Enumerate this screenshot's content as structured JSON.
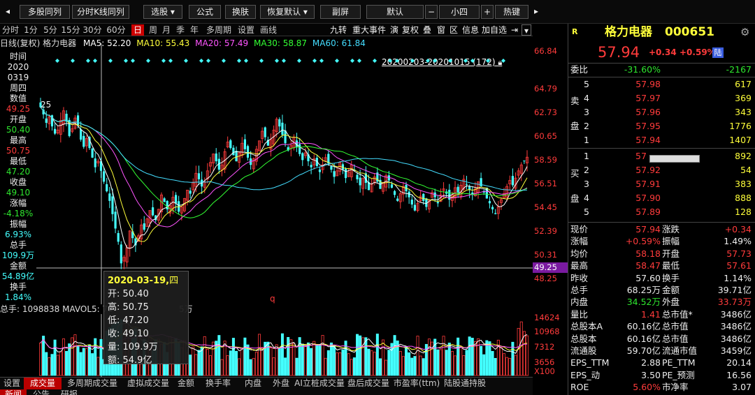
{
  "toolbar": {
    "buttons": [
      "多股同列",
      "分时K线同列",
      "选股 ▾",
      "公式",
      "换肤",
      "恢复默认 ▾",
      "副屏",
      "默认",
      "小四",
      "热键"
    ],
    "scroll_left": "◂",
    "scroll_right": "▸",
    "minus": "−",
    "plus": "+"
  },
  "periods": [
    "分时",
    "1分",
    "5分",
    "15分",
    "30分",
    "60分",
    "日",
    "周",
    "月",
    "季",
    "年",
    "多周期",
    "设置",
    "画线"
  ],
  "active_period": "日",
  "right_tools": [
    "九转",
    "重大事件",
    "演",
    "复权",
    "叠",
    "窗",
    "区",
    "信息",
    "加自选",
    "⇥"
  ],
  "header": {
    "label": "日线(复权) 格力电器",
    "ma5": "MA5: 52.20",
    "ma10": "MA10: 55.43",
    "ma20": "MA20: 57.49",
    "ma30": "MA30: 58.87",
    "ma60": "MA60: 61.84",
    "range": "20200203-20201015 (172)",
    "colors": {
      "ma5": "#ffffff",
      "ma10": "#ffff3a",
      "ma20": "#ff55ff",
      "ma30": "#33ff33",
      "ma60": "#44ddff"
    }
  },
  "price_axis": [
    "66.84",
    "64.79",
    "62.73",
    "60.65",
    "58.59",
    "56.51",
    "54.45",
    "52.39",
    "50.31",
    "48.25"
  ],
  "crosshair_price": "49.25",
  "vol_axis": [
    "14624",
    "10968",
    "7312",
    "3656",
    "X100"
  ],
  "left_info": [
    {
      "k": "时间",
      "v": "2020"
    },
    {
      "k": "0319",
      "v": "周四"
    },
    {
      "k": "数值",
      "v": "49.25"
    },
    {
      "k": "开盘",
      "v": "50.40"
    },
    {
      "k": "最高",
      "v": "50.75"
    },
    {
      "k": "最低",
      "v": "47.20"
    },
    {
      "k": "收盘",
      "v": "49.10"
    },
    {
      "k": "涨幅",
      "v": "-4.18%"
    },
    {
      "k": "振幅",
      "v": "6.93%"
    },
    {
      "k": "总手",
      "v": "109.9万"
    },
    {
      "k": "金额",
      "v": "54.89亿"
    },
    {
      "k": "换手",
      "v": "1.84%"
    }
  ],
  "chart_marker": "25",
  "low_marker": "q",
  "vol_header": "总手: 1098838  MAVOL5: 70",
  "vol_header_tail": "5万",
  "tooltip": {
    "date": "2020-03-19,",
    "weekday": "四",
    "open": "开: 50.40",
    "high": "高: 50.75",
    "low": "低: 47.20",
    "close": "收: 49.10",
    "volume": "量: 109.9万",
    "amount": "额: 54.9亿"
  },
  "bottom_tabs": [
    "设置",
    "成交量",
    "多周期成交量",
    "虚拟成交量",
    "金额",
    "换手率",
    "内盘",
    "外盘",
    "AI立桩成交量",
    "盘后成交量",
    "市盈率(ttm)",
    "陆股通持股"
  ],
  "active_tab": "成交量",
  "bottom_tabs2": [
    "新闻",
    "公告",
    "研报"
  ],
  "stock": {
    "r": "R",
    "name": "格力电器",
    "code": "000651",
    "price": "57.94",
    "change": "+0.34",
    "pct": "+0.59%",
    "badge": "陆"
  },
  "weibi": {
    "label": "委比",
    "pct": "-31.60%",
    "diff": "-2167"
  },
  "sell": [
    {
      "n": "5",
      "p": "57.98",
      "v": "617"
    },
    {
      "n": "4",
      "p": "57.97",
      "v": "369"
    },
    {
      "n": "3",
      "p": "57.96",
      "v": "343"
    },
    {
      "n": "2",
      "p": "57.95",
      "v": "1776"
    },
    {
      "n": "1",
      "p": "57.94",
      "v": "1407"
    }
  ],
  "buy": [
    {
      "n": "1",
      "p": "57",
      "v": "892"
    },
    {
      "n": "2",
      "p": "57.92",
      "v": "54"
    },
    {
      "n": "3",
      "p": "57.91",
      "v": "383"
    },
    {
      "n": "4",
      "p": "57.90",
      "v": "888"
    },
    {
      "n": "5",
      "p": "57.89",
      "v": "128"
    }
  ],
  "sell_label": [
    "卖",
    "盘"
  ],
  "buy_label": [
    "买",
    "盘"
  ],
  "stats": [
    {
      "k1": "现价",
      "v1": "57.94",
      "k2": "涨跌",
      "v2": "+0.34",
      "c1": "red",
      "c2": "red"
    },
    {
      "k1": "涨幅",
      "v1": "+0.59%",
      "k2": "振幅",
      "v2": "1.49%",
      "c1": "red",
      "c2": "white"
    },
    {
      "k1": "均价",
      "v1": "58.18",
      "k2": "开盘",
      "v2": "57.73",
      "c1": "red",
      "c2": "red"
    },
    {
      "k1": "最高",
      "v1": "58.47",
      "k2": "最低",
      "v2": "57.61",
      "c1": "red",
      "c2": "red"
    },
    {
      "k1": "昨收",
      "v1": "57.60",
      "k2": "换手",
      "v2": "1.14%",
      "c1": "white",
      "c2": "white"
    },
    {
      "k1": "总手",
      "v1": "68.25万",
      "k2": "金额",
      "v2": "39.71亿",
      "c1": "white",
      "c2": "white"
    },
    {
      "k1": "内盘",
      "v1": "34.52万",
      "k2": "外盘",
      "v2": "33.73万",
      "c1": "green",
      "c2": "red"
    },
    {
      "k1": "量比",
      "v1": "1.41",
      "k2": "总市值*",
      "v2": "3486亿",
      "c1": "red",
      "c2": "white"
    },
    {
      "k1": "总股本A",
      "v1": "60.16亿",
      "k2": "总市值",
      "v2": "3486亿",
      "c1": "white",
      "c2": "white"
    },
    {
      "k1": "总股本",
      "v1": "60.16亿",
      "k2": "总市值",
      "v2": "3486亿",
      "c1": "white",
      "c2": "white"
    },
    {
      "k1": "流通股",
      "v1": "59.70亿",
      "k2": "流通市值",
      "v2": "3459亿",
      "c1": "white",
      "c2": "white"
    },
    {
      "k1": "EPS_TTM",
      "v1": "2.88",
      "k2": "PE_TTM",
      "v2": "20.14",
      "c1": "white",
      "c2": "white"
    },
    {
      "k1": "EPS_动",
      "v1": "3.50",
      "k2": "PE_预测",
      "v2": "16.56",
      "c1": "white",
      "c2": "white"
    },
    {
      "k1": "ROE",
      "v1": "5.60%",
      "k2": "市净率",
      "v2": "3.07",
      "c1": "red",
      "c2": "white"
    }
  ],
  "chart_data": {
    "type": "candlestick",
    "title": "格力电器 000651 日线(复权)",
    "x_range": [
      "2020-02-03",
      "2020-10-15"
    ],
    "bar_count": 172,
    "ylim": [
      48.25,
      66.84
    ],
    "ma": {
      "MA5": 52.2,
      "MA10": 55.43,
      "MA20": 57.49,
      "MA30": 58.87,
      "MA60": 61.84
    },
    "selected": {
      "date": "2020-03-19",
      "open": 50.4,
      "high": 50.75,
      "low": 47.2,
      "close": 49.1,
      "volume": "109.9万",
      "amount": "54.9亿"
    },
    "close": [
      62.1,
      61.5,
      60.8,
      61.3,
      60.5,
      59.9,
      60.2,
      61.0,
      61.8,
      60.9,
      59.7,
      60.3,
      61.2,
      60.6,
      59.4,
      58.8,
      59.5,
      58.7,
      57.9,
      57.1,
      57.6,
      56.8,
      55.9,
      55.1,
      54.3,
      53.2,
      52.0,
      50.9,
      49.1,
      49.6,
      50.4,
      51.8,
      51.2,
      50.6,
      51.4,
      52.3,
      51.9,
      52.8,
      53.5,
      53.1,
      52.7,
      53.6,
      54.8,
      54.2,
      53.6,
      53.9,
      54.6,
      54.1,
      53.4,
      53.8,
      54.5,
      55.2,
      54.9,
      55.8,
      56.6,
      56.1,
      55.5,
      55.9,
      56.8,
      57.5,
      58.2,
      57.6,
      56.9,
      57.3,
      58.4,
      59.2,
      58.7,
      58.1,
      57.6,
      58.3,
      59.1,
      58.6,
      57.9,
      57.3,
      57.8,
      58.6,
      59.3,
      60.1,
      59.6,
      58.9,
      59.4,
      60.2,
      61.1,
      60.5,
      59.8,
      59.1,
      58.5,
      58.9,
      59.6,
      58.8,
      58.2,
      57.7,
      58.3,
      57.6,
      57.1,
      57.8,
      57.2,
      56.7,
      57.3,
      57.9,
      57.4,
      56.9,
      56.3,
      56.8,
      57.5,
      56.9,
      56.2,
      56.7,
      57.3,
      56.8,
      56.1,
      55.6,
      56.2,
      55.8,
      55.2,
      55.7,
      56.3,
      55.9,
      55.3,
      55.8,
      56.4,
      56.0,
      55.4,
      54.8,
      54.3,
      54.9,
      55.5,
      55.1,
      54.6,
      54.0,
      53.5,
      54.1,
      54.7,
      54.3,
      53.8,
      54.4,
      55.0,
      54.6,
      54.1,
      54.8,
      55.3,
      54.9,
      54.4,
      54.8,
      55.4,
      55.0,
      55.6,
      56.1,
      55.7,
      55.2,
      54.8,
      55.3,
      55.9,
      55.5,
      55.0,
      54.5,
      54.1,
      53.6,
      53.2,
      53.8,
      54.4,
      54.9,
      55.5,
      56.0,
      55.6,
      56.2,
      56.8,
      57.3,
      57.6,
      57.94
    ],
    "volume_ylim": [
      0,
      14624
    ]
  }
}
